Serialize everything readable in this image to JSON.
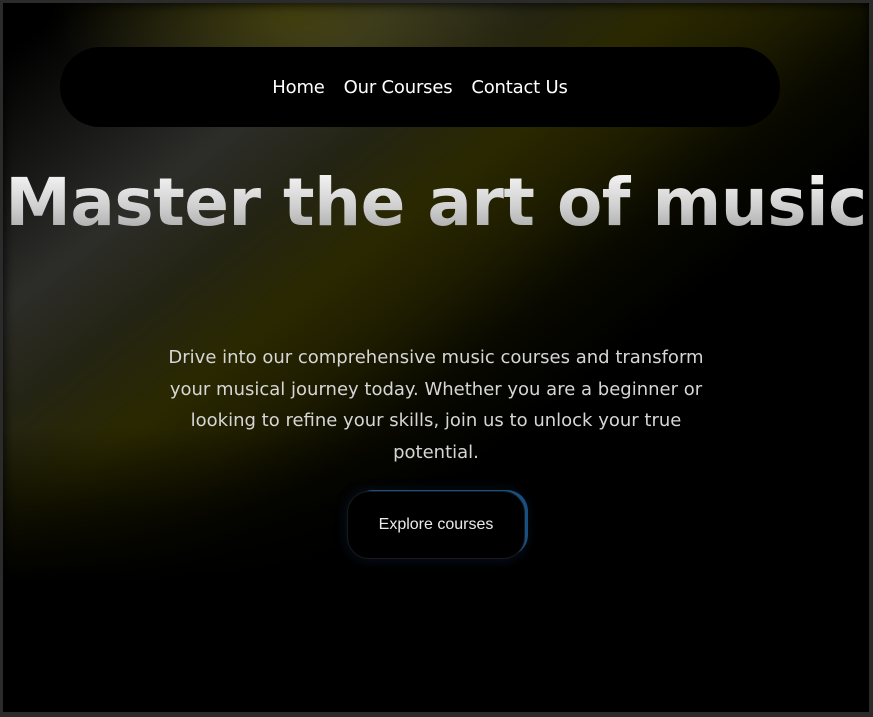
{
  "nav": {
    "links": [
      {
        "label": "Home"
      },
      {
        "label": "Our Courses"
      },
      {
        "label": "Contact Us"
      }
    ]
  },
  "hero": {
    "title": "Master the art of music",
    "description": "Drive into our comprehensive music courses and transform your musical journey today. Whether you are a beginner or looking to refine your skills, join us to unlock your true potential.",
    "cta_label": "Explore courses"
  },
  "colors": {
    "background": "#000000",
    "accent_yellow": "#5c5800",
    "button_glow": "#288ce6",
    "text_primary": "#ffffff"
  }
}
